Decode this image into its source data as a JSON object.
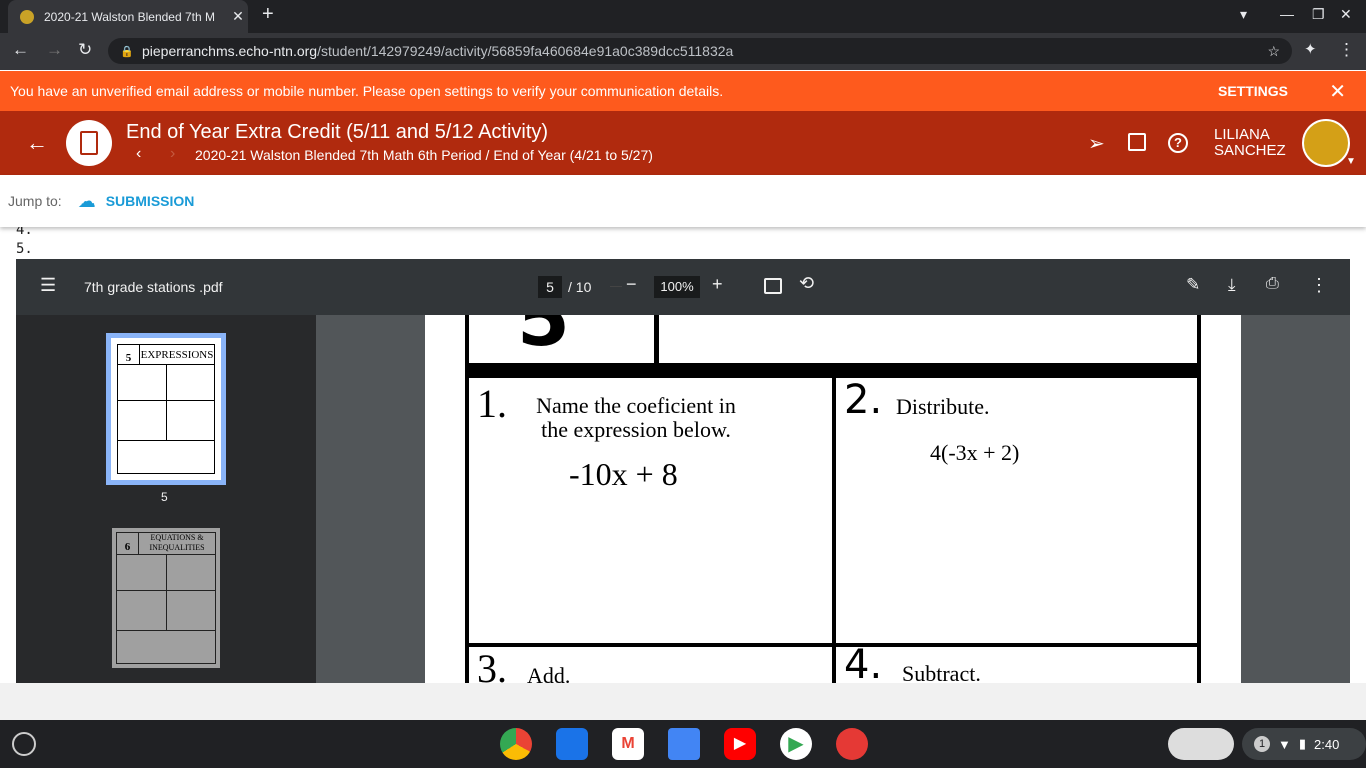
{
  "browser": {
    "tab_title": "2020-21 Walston Blended 7th M",
    "url_host": "pieperranchms.echo-ntn.org",
    "url_path": "/student/142979249/activity/56859fa460684e91a0c389dcc511832a"
  },
  "banner": {
    "message": "You have an unverified email address or mobile number. Please open settings to verify your communication details.",
    "settings": "SETTINGS"
  },
  "header": {
    "title": "End of Year Extra Credit (5/11 and 5/12 Activity)",
    "breadcrumb": "2020-21 Walston Blended 7th Math 6th Period / End of Year (4/21 to 5/27)",
    "user_first": "LILIANA",
    "user_last": "SANCHEZ"
  },
  "jump": {
    "label": "Jump to:",
    "submission": "SUBMISSION"
  },
  "list": [
    "4.",
    "5."
  ],
  "pdf": {
    "filename": "7th grade stations .pdf",
    "page": "5",
    "total": "/ 10",
    "zoom": "100%",
    "thumbs": [
      {
        "label": "5",
        "station": "5",
        "title": "EXPRESSIONS"
      },
      {
        "label": "6",
        "station": "6",
        "title": "EQUATIONS & INEQUALITIES"
      }
    ],
    "content": {
      "station": "5",
      "q1_num": "1.",
      "q1": "Name the coeficient in the expression below.",
      "q1_expr": "-10x + 8",
      "q2_num": "2.",
      "q2": "Distribute.",
      "q2_expr": "4(-3x + 2)",
      "q3_num": "3.",
      "q3": "Add.",
      "q4_num": "4.",
      "q4": "Subtract."
    }
  },
  "shelf": {
    "time": "2:40",
    "notif": "1"
  }
}
